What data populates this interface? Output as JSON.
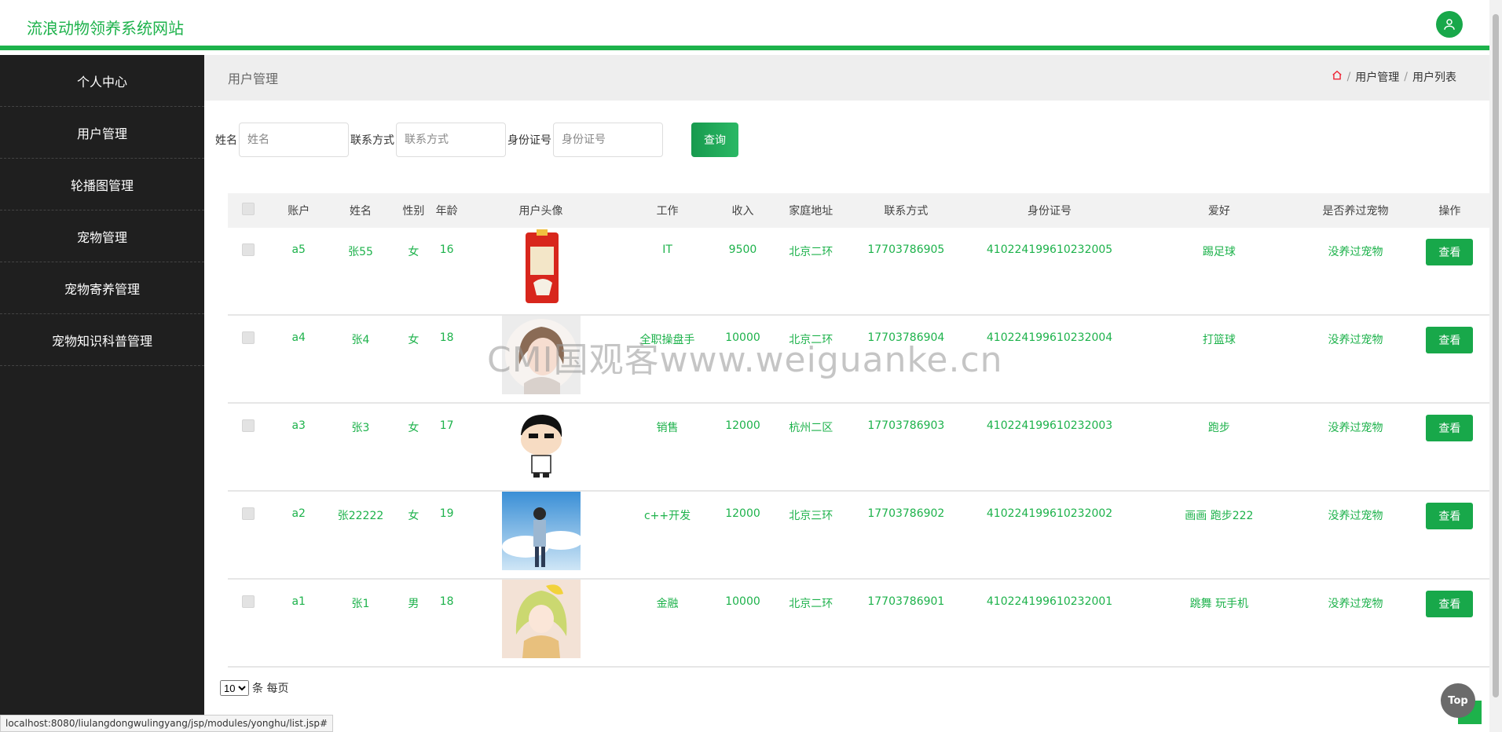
{
  "header": {
    "site_title": "流浪动物领养系统网站"
  },
  "sidebar": {
    "items": [
      {
        "label": "个人中心"
      },
      {
        "label": "用户管理"
      },
      {
        "label": "轮播图管理"
      },
      {
        "label": "宠物管理"
      },
      {
        "label": "宠物寄养管理"
      },
      {
        "label": "宠物知识科普管理"
      }
    ]
  },
  "crumb": {
    "title": "用户管理",
    "path1": "用户管理",
    "path2": "用户列表",
    "sep": "/"
  },
  "search": {
    "name_label": "姓名",
    "name_placeholder": "姓名",
    "phone_label": "联系方式",
    "phone_placeholder": "联系方式",
    "id_label": "身份证号",
    "id_placeholder": "身份证号",
    "query_label": "查询"
  },
  "table": {
    "headers": [
      "账户",
      "姓名",
      "性别",
      "年龄",
      "用户头像",
      "工作",
      "收入",
      "家庭地址",
      "联系方式",
      "身份证号",
      "爱好",
      "是否养过宠物",
      "操作"
    ],
    "rows": [
      {
        "account": "a5",
        "name": "张55",
        "gender": "女",
        "age": "16",
        "job": "IT",
        "income": "9500",
        "address": "北京二环",
        "phone": "17703786905",
        "idno": "410224199610232005",
        "hobby": "踢足球",
        "pet": "没养过宠物",
        "action": "查看"
      },
      {
        "account": "a4",
        "name": "张4",
        "gender": "女",
        "age": "18",
        "job": "全职操盘手",
        "income": "10000",
        "address": "北京二环",
        "phone": "17703786904",
        "idno": "410224199610232004",
        "hobby": "打篮球",
        "pet": "没养过宠物",
        "action": "查看"
      },
      {
        "account": "a3",
        "name": "张3",
        "gender": "女",
        "age": "17",
        "job": "销售",
        "income": "12000",
        "address": "杭州二区",
        "phone": "17703786903",
        "idno": "410224199610232003",
        "hobby": "跑步",
        "pet": "没养过宠物",
        "action": "查看"
      },
      {
        "account": "a2",
        "name": "张22222",
        "gender": "女",
        "age": "19",
        "job": "c++开发",
        "income": "12000",
        "address": "北京三环",
        "phone": "17703786902",
        "idno": "410224199610232002",
        "hobby": "画画 跑步222",
        "pet": "没养过宠物",
        "action": "查看"
      },
      {
        "account": "a1",
        "name": "张1",
        "gender": "男",
        "age": "18",
        "job": "金融",
        "income": "10000",
        "address": "北京二环",
        "phone": "17703786901",
        "idno": "410224199610232001",
        "hobby": "跳舞 玩手机",
        "pet": "没养过宠物",
        "action": "查看"
      }
    ]
  },
  "pager": {
    "page_size": "10",
    "suffix": "条 每页"
  },
  "watermark": "CMI国观客www.weiguanke.cn",
  "status_url": "localhost:8080/liulangdongwulingyang/jsp/modules/yonghu/list.jsp#",
  "top_button": "Top",
  "colors": {
    "accent": "#1db24b",
    "sidebar_bg": "#1f1f1f"
  }
}
